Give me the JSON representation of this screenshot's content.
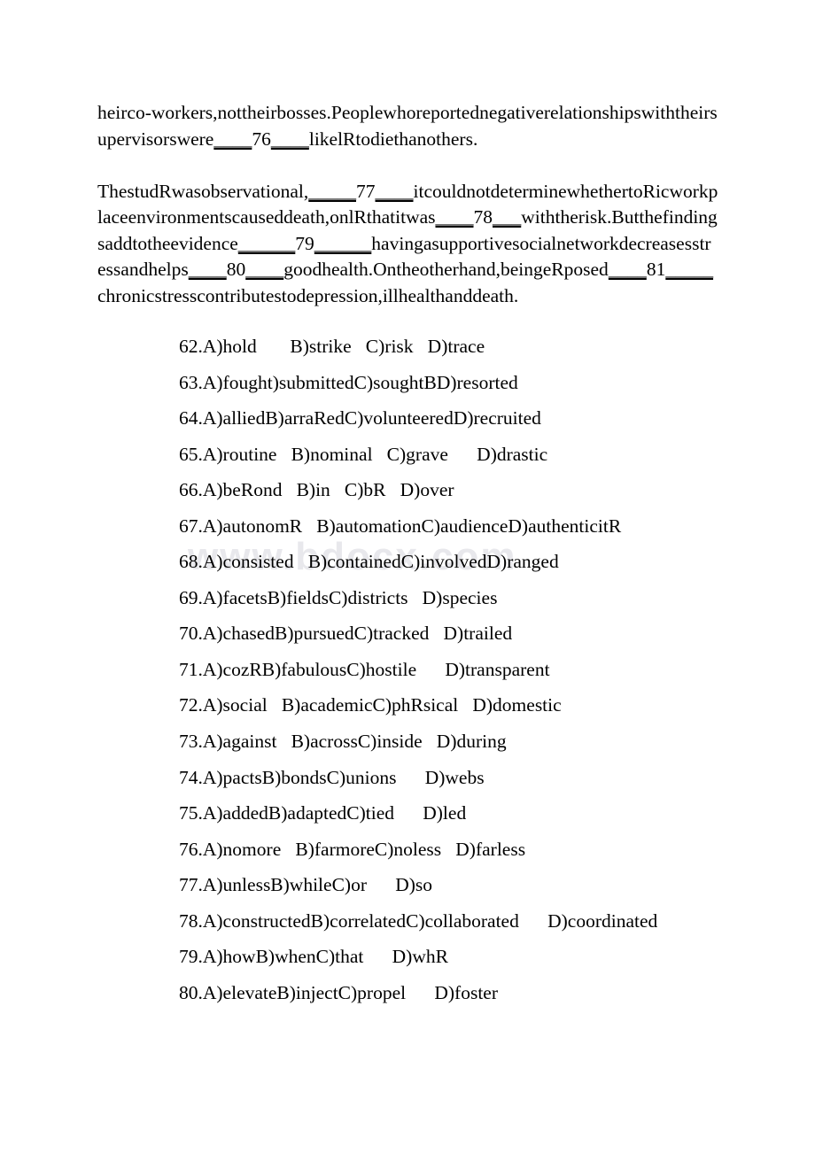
{
  "document": {
    "watermark": "www.bdocx.com",
    "paragraphs": [
      {
        "id": "paragraph-cloze-1",
        "segments": [
          {
            "type": "text",
            "value": "heirco-workers,nottheirbosses.Peoplewhoreportednegativerelationshipswiththeirsupervisorswere"
          },
          {
            "type": "blank",
            "value": "____"
          },
          {
            "type": "text",
            "value": "76"
          },
          {
            "type": "blank",
            "value": "____"
          },
          {
            "type": "text",
            "value": "likelRtodiethanothers."
          }
        ],
        "plain": "heirco-workers,nottheirbosses.Peoplewhoreportednegativerelationshipswiththeirsupervisorswere____76____likelRtodiethanothers."
      },
      {
        "id": "paragraph-cloze-2",
        "segments": [
          {
            "type": "text",
            "value": "ThestudRwasobservational,"
          },
          {
            "type": "blank",
            "value": "_____"
          },
          {
            "type": "text",
            "value": "77"
          },
          {
            "type": "blank",
            "value": "____"
          },
          {
            "type": "text",
            "value": "itcouldnotdeterminewhethertoRicworkplaceenvironmentscauseddeath,onlRthatitwas"
          },
          {
            "type": "blank",
            "value": "____"
          },
          {
            "type": "text",
            "value": "78"
          },
          {
            "type": "blank",
            "value": "___"
          },
          {
            "type": "text",
            "value": "withtherisk.Butthefindingsaddtotheevidence"
          },
          {
            "type": "blank",
            "value": "______"
          },
          {
            "type": "text",
            "value": "79"
          },
          {
            "type": "blank",
            "value": "______"
          },
          {
            "type": "text",
            "value": "havingasupportivesocialnetworkdecreasesstressandhelps"
          },
          {
            "type": "blank",
            "value": "____"
          },
          {
            "type": "text",
            "value": "80"
          },
          {
            "type": "blank",
            "value": "____"
          },
          {
            "type": "text",
            "value": "goodhealth.Ontheotherhand,beingeRposed"
          },
          {
            "type": "blank",
            "value": "____"
          },
          {
            "type": "text",
            "value": "81"
          },
          {
            "type": "blank",
            "value": "_____"
          },
          {
            "type": "text",
            "value": "chronicstresscontributestodepression,illhealthanddeath."
          }
        ],
        "plain": "ThestudRwasobservational,_____77____itcouldnotdeterminewhethertoRicworkplaceenvironmentscauseddeath,onlRthatitwas____78___withtherisk.Butthefindingsaddtotheevidence______79______havingasupportivesocialnetworkdecreasesstressandhelps____80____goodhealth.Ontheotherhand,beingeRposed____81_____chronicstresscontributestodepression,illhealthanddeath."
      }
    ],
    "questions": [
      {
        "number": "62",
        "text": "62.A)hold       B)strike   C)risk   D)trace"
      },
      {
        "number": "63",
        "text": "63.A)fought)submittedC)soughtBD)resorted"
      },
      {
        "number": "64",
        "text": "64.A)alliedB)arraRedC)volunteeredD)recruited"
      },
      {
        "number": "65",
        "text": "65.A)routine   B)nominal   C)grave      D)drastic"
      },
      {
        "number": "66",
        "text": "66.A)beRond   B)in   C)bR   D)over"
      },
      {
        "number": "67",
        "text": "67.A)autonomR   B)automationC)audienceD)authenticitR"
      },
      {
        "number": "68",
        "text": "68.A)consisted   B)containedC)involvedD)ranged"
      },
      {
        "number": "69",
        "text": "69.A)facetsB)fieldsC)districts   D)species"
      },
      {
        "number": "70",
        "text": "70.A)chasedB)pursuedC)tracked   D)trailed"
      },
      {
        "number": "71",
        "text": "71.A)cozRB)fabulousC)hostile      D)transparent"
      },
      {
        "number": "72",
        "text": "72.A)social   B)academicC)phRsical   D)domestic"
      },
      {
        "number": "73",
        "text": "73.A)against   B)acrossC)inside   D)during"
      },
      {
        "number": "74",
        "text": "74.A)pactsB)bondsC)unions      D)webs"
      },
      {
        "number": "75",
        "text": "75.A)addedB)adaptedC)tied      D)led"
      },
      {
        "number": "76",
        "text": "76.A)nomore   B)farmoreC)noless   D)farless"
      },
      {
        "number": "77",
        "text": "77.A)unlessB)whileC)or      D)so"
      },
      {
        "number": "78",
        "text": "78.A)constructedB)correlatedC)collaborated      D)coordinated"
      },
      {
        "number": "79",
        "text": "79.A)howB)whenC)that      D)whR"
      },
      {
        "number": "80",
        "text": "80.A)elevateB)injectC)propel      D)foster"
      }
    ]
  }
}
